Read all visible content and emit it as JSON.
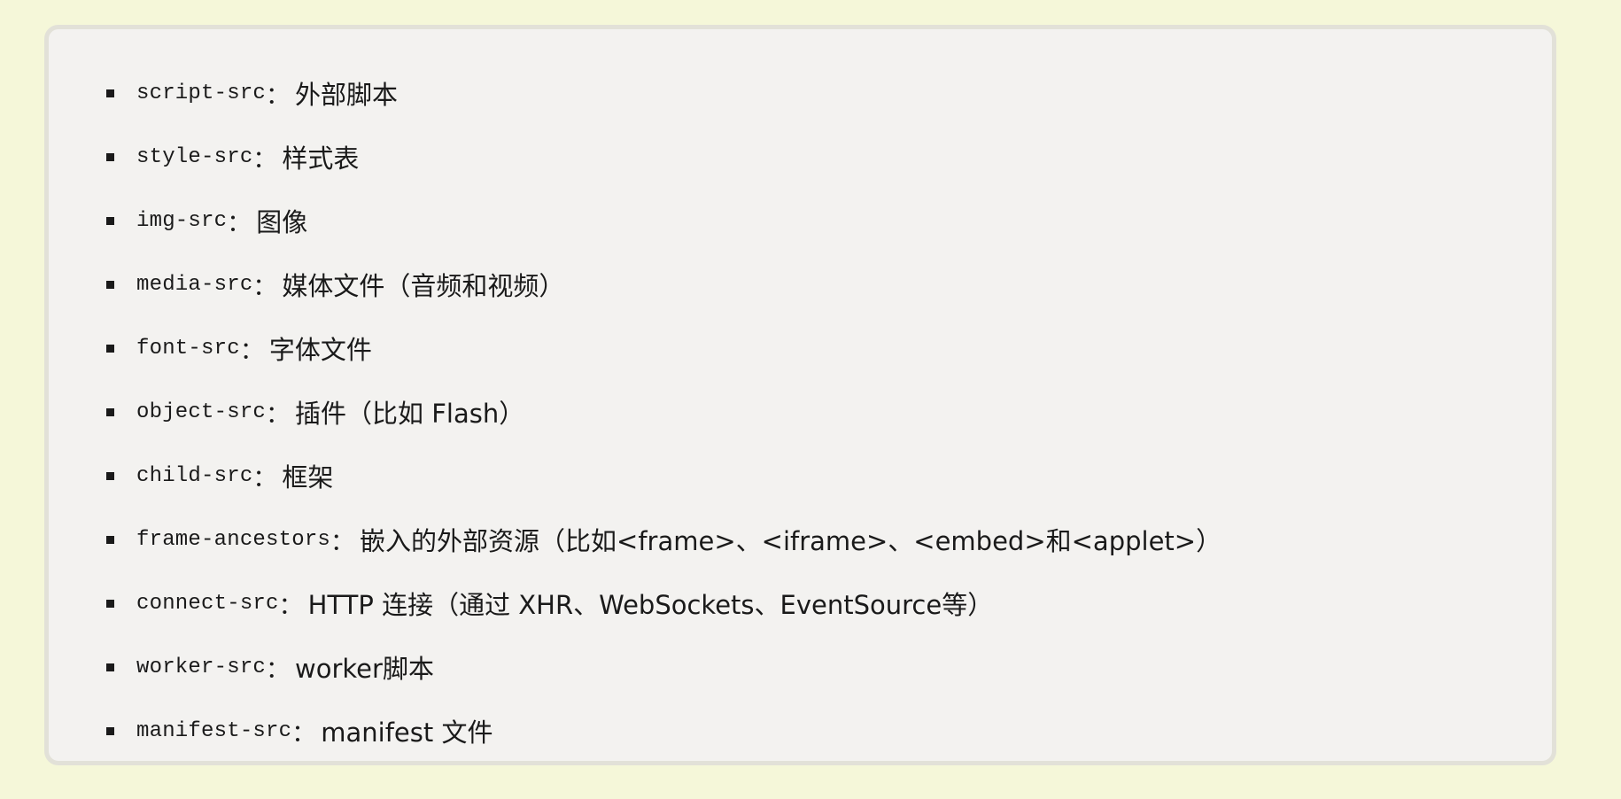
{
  "directives": [
    {
      "name": "script-src",
      "separator": "：",
      "description": "外部脚本"
    },
    {
      "name": "style-src",
      "separator": "：",
      "description": "样式表"
    },
    {
      "name": "img-src",
      "separator": "：",
      "description": "图像"
    },
    {
      "name": "media-src",
      "separator": "：",
      "description": "媒体文件（音频和视频）"
    },
    {
      "name": "font-src",
      "separator": "：",
      "description": "字体文件"
    },
    {
      "name": "object-src",
      "separator": "：",
      "description": "插件（比如 Flash）"
    },
    {
      "name": "child-src",
      "separator": "：",
      "description": "框架"
    },
    {
      "name": "frame-ancestors",
      "separator": "：",
      "description": "嵌入的外部资源（比如<frame>、<iframe>、<embed>和<applet>）"
    },
    {
      "name": "connect-src",
      "separator": "：",
      "description": "HTTP 连接（通过 XHR、WebSockets、EventSource等）"
    },
    {
      "name": "worker-src",
      "separator": "：",
      "description": "worker脚本"
    },
    {
      "name": "manifest-src",
      "separator": "：",
      "description": "manifest 文件"
    }
  ]
}
